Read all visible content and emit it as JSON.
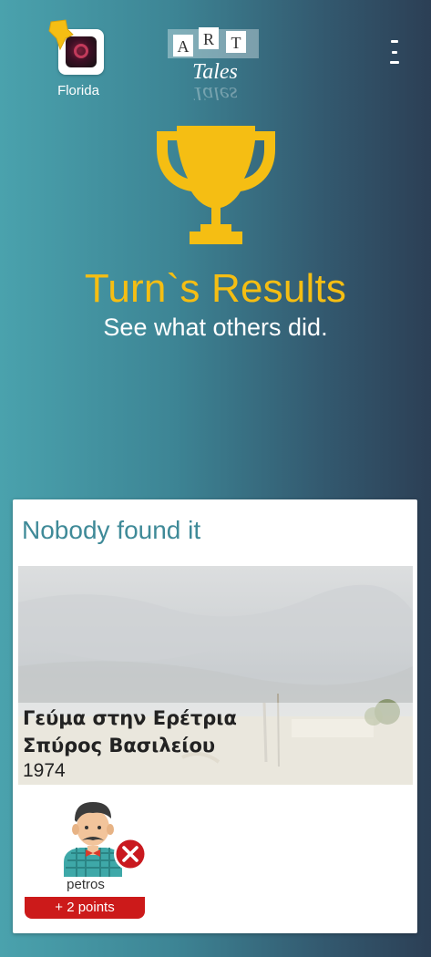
{
  "header": {
    "user_name": "Florida",
    "logo_letters": [
      "A",
      "R",
      "T"
    ],
    "logo_word": "Tales"
  },
  "results": {
    "title": "Turn`s Results",
    "subtitle": "See what others did."
  },
  "card": {
    "heading": "Nobody found it",
    "artwork": {
      "title": "Γεύμα στην Ερέτρια",
      "artist": "Σπύρος Βασιλείου",
      "year": "1974"
    },
    "players": [
      {
        "name": "petros",
        "points": "+ 2 points",
        "status": "wrong"
      }
    ]
  },
  "colors": {
    "accent_yellow": "#f5be13",
    "heading_teal": "#3f8a98",
    "badge_red": "#cc1a1a"
  },
  "icons": {
    "menu": "kebab-menu-icon",
    "trophy": "trophy-icon",
    "wrong": "close-circle-icon"
  }
}
